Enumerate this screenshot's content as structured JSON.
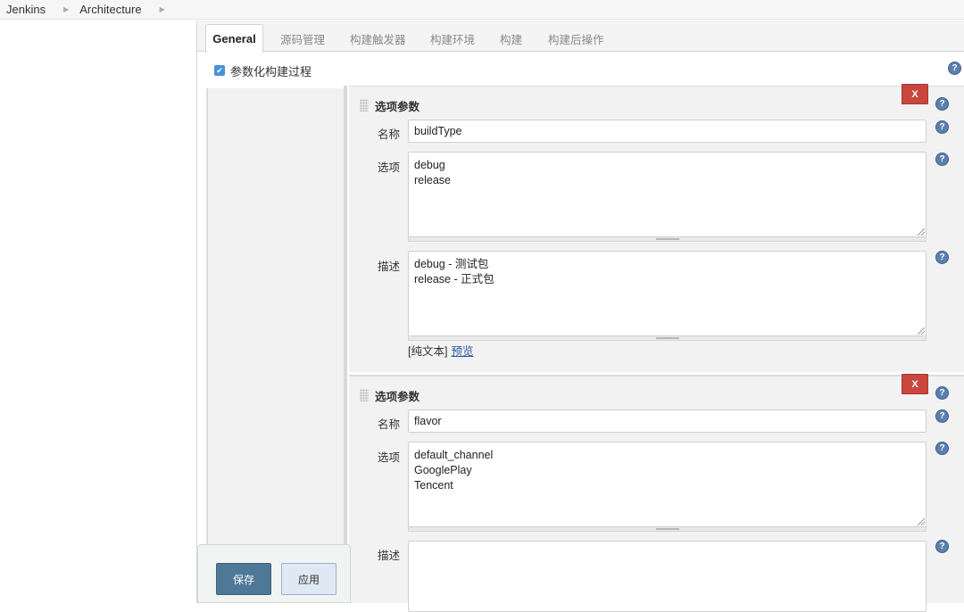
{
  "breadcrumb": {
    "items": [
      "Jenkins",
      "Architecture"
    ]
  },
  "tabs": [
    "General",
    "源码管理",
    "构建触发器",
    "构建环境",
    "构建",
    "构建后操作"
  ],
  "parameterized": {
    "label": "参数化构建过程",
    "checked": true
  },
  "blocks": [
    {
      "title": "选项参数",
      "delete_label": "X",
      "name_label": "名称",
      "name_value": "buildType",
      "choices_label": "选项",
      "choices": [
        "debug",
        "release"
      ],
      "desc_label": "描述",
      "desc_lines": [
        "debug - 测试包",
        "release - 正式包"
      ],
      "format_text": "[纯文本]",
      "preview_link": "预览"
    },
    {
      "title": "选项参数",
      "delete_label": "X",
      "name_label": "名称",
      "name_value": "flavor",
      "choices_label": "选项",
      "choices": [
        "default_channel",
        "GooglePlay",
        "Tencent"
      ],
      "desc_label": "描述",
      "desc_lines": []
    }
  ],
  "help_symbol": "?",
  "actions": {
    "save": "保存",
    "apply": "应用"
  },
  "colors": {
    "delete": "#c9463d",
    "save": "#4e7896",
    "apply": "#dfe9f3",
    "help": "#5b7fae",
    "link": "#2a57a8"
  },
  "icons": [
    "chevron-right-icon",
    "check-icon",
    "help-icon",
    "grip-icon",
    "resize-grip-icon"
  ]
}
